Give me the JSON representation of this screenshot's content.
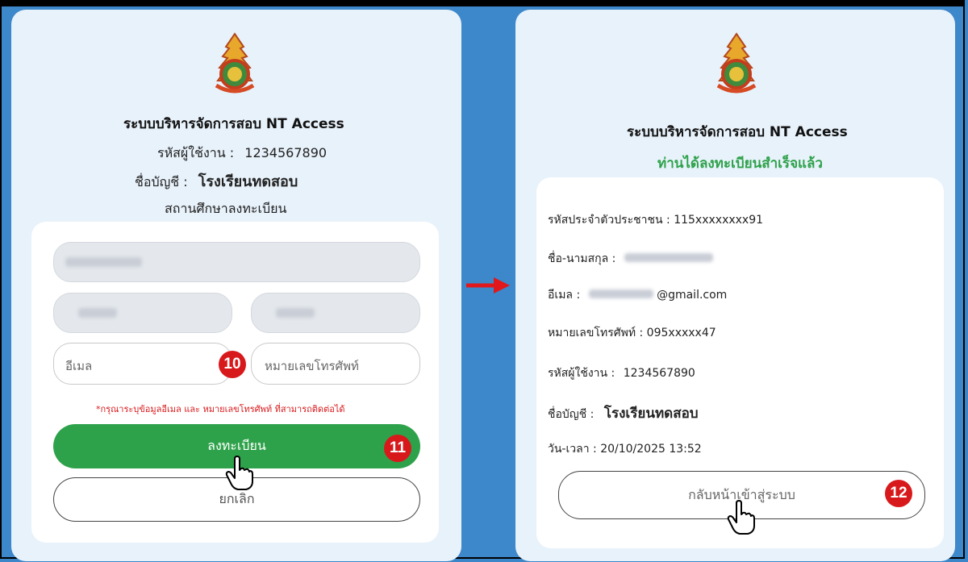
{
  "system_title": "ระบบบริหารจัดการสอบ NT Access",
  "left": {
    "username_label": "รหัสผู้ใช้งาน :",
    "username_value": "1234567890",
    "account_label": "ชื่อบัญชี :",
    "account_value": "โรงเรียนทดสอบ",
    "section_label": "สถานศึกษาลงทะเบียน",
    "email_placeholder": "อีเมล",
    "phone_placeholder": "หมายเลขโทรศัพท์",
    "warning": "*กรุณาระบุข้อมูลอีเมล และ หมายเลขโทรศัพท์ ที่สามารถติดต่อได้",
    "register_button": "ลงทะเบียน",
    "cancel_button": "ยกเลิก",
    "badge_10": "10",
    "badge_11": "11"
  },
  "right": {
    "success_text": "ท่านได้ลงทะเบียนสำเร็จแล้ว",
    "id_label": "รหัสประจำตัวประชาชน : 115xxxxxxxx91",
    "name_label": "ชื่อ-นามสกุล :",
    "email_label": "อีเมล :",
    "email_suffix": "@gmail.com",
    "phone_label": "หมายเลขโทรศัพท์ : 095xxxxx47",
    "username_label": "รหัสผู้ใช้งาน :",
    "username_value": "1234567890",
    "account_label": "ชื่อบัญชี :",
    "account_value": "โรงเรียนทดสอบ",
    "datetime": "วัน-เวลา : 20/10/2025 13:52",
    "back_button": "กลับหน้าเข้าสู่ระบบ",
    "badge_12": "12"
  },
  "colors": {
    "success": "#2ea24a",
    "warning": "#d8191c",
    "badge": "#d8191c",
    "background": "#3d87cb"
  }
}
